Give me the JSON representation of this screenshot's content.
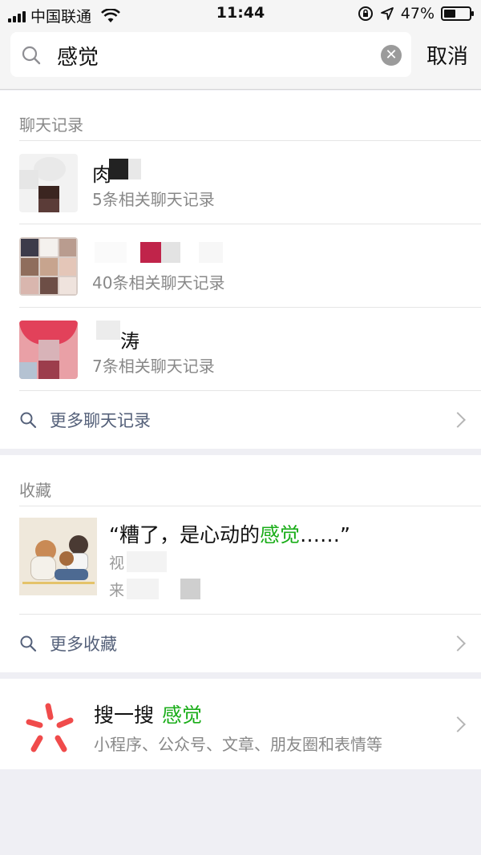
{
  "status_bar": {
    "carrier": "中国联通",
    "time": "11:44",
    "battery_percent": "47%",
    "battery_level": 0.47
  },
  "search": {
    "query": "感觉",
    "cancel_label": "取消"
  },
  "chat_section": {
    "title": "聊天记录",
    "items": [
      {
        "name": "肉",
        "sub": "5条相关聊天记录"
      },
      {
        "name": "",
        "sub": "40条相关聊天记录"
      },
      {
        "name": "涛",
        "sub": "7条相关聊天记录"
      }
    ],
    "more_label": "更多聊天记录"
  },
  "favorites_section": {
    "title": "收藏",
    "item": {
      "quote_before": "“糟了，是心动的",
      "quote_highlight": "感觉",
      "quote_after": "……”",
      "sub_line1": "视",
      "sub_line2": "来"
    },
    "more_label": "更多收藏"
  },
  "sousou": {
    "title": "搜一搜",
    "keyword": "感觉",
    "sub": "小程序、公众号、文章、朋友圈和表情等"
  },
  "colors": {
    "highlight": "#1aad19",
    "link": "#55617a",
    "logo_red": "#f04b4b"
  }
}
